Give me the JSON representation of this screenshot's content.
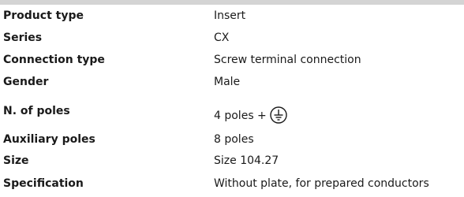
{
  "spec": {
    "product_type": {
      "label": "Product type",
      "value": "Insert"
    },
    "series": {
      "label": "Series",
      "value": "CX"
    },
    "connection_type": {
      "label": "Connection type",
      "value": "Screw terminal connection"
    },
    "gender": {
      "label": "Gender",
      "value": "Male"
    },
    "poles": {
      "label": "N. of poles",
      "value": "4 poles +",
      "icon": "protective-earth-icon"
    },
    "auxiliary_poles": {
      "label": "Auxiliary poles",
      "value": "8 poles"
    },
    "size": {
      "label": "Size",
      "value": "Size 104.27"
    },
    "specification": {
      "label": "Specification",
      "value": "Without plate, for prepared conductors"
    }
  },
  "colors": {
    "header_bar": "#d4d4d4",
    "text": "#1a1a1a"
  }
}
